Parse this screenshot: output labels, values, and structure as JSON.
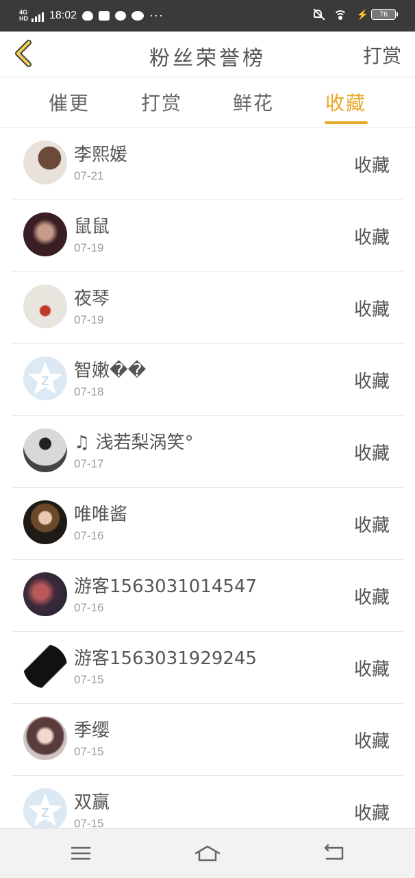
{
  "status_bar": {
    "network": "4G HD",
    "time": "18:02",
    "battery": "76"
  },
  "header": {
    "title": "粉丝荣誉榜",
    "right_action": "打赏"
  },
  "tabs": [
    {
      "label": "催更"
    },
    {
      "label": "打赏"
    },
    {
      "label": "鲜花"
    },
    {
      "label": "收藏"
    }
  ],
  "active_tab": "收藏",
  "accent_color": "#e8a726",
  "fans": [
    {
      "name": "李熙媛",
      "date": "07-21",
      "action": "收藏",
      "avatar": "photo"
    },
    {
      "name": "鼠鼠",
      "date": "07-19",
      "action": "收藏",
      "avatar": "photo"
    },
    {
      "name": "夜琴",
      "date": "07-19",
      "action": "收藏",
      "avatar": "drawing"
    },
    {
      "name": "智嫩��",
      "date": "07-18",
      "action": "收藏",
      "avatar": "default-qq"
    },
    {
      "name": "♫ 浅若梨涡笑°",
      "date": "07-17",
      "action": "收藏",
      "avatar": "photo"
    },
    {
      "name": "唯唯酱",
      "date": "07-16",
      "action": "收藏",
      "avatar": "photo"
    },
    {
      "name": "游客1563031014547",
      "date": "07-16",
      "action": "收藏",
      "avatar": "photo"
    },
    {
      "name": "游客1563031929245",
      "date": "07-15",
      "action": "收藏",
      "avatar": "drawing"
    },
    {
      "name": "季缨",
      "date": "07-15",
      "action": "收藏",
      "avatar": "photo"
    },
    {
      "name": "双赢",
      "date": "07-15",
      "action": "收藏",
      "avatar": "default-qq"
    }
  ],
  "nav": {
    "menu": "menu-icon",
    "home": "home-icon",
    "back": "back-icon"
  }
}
